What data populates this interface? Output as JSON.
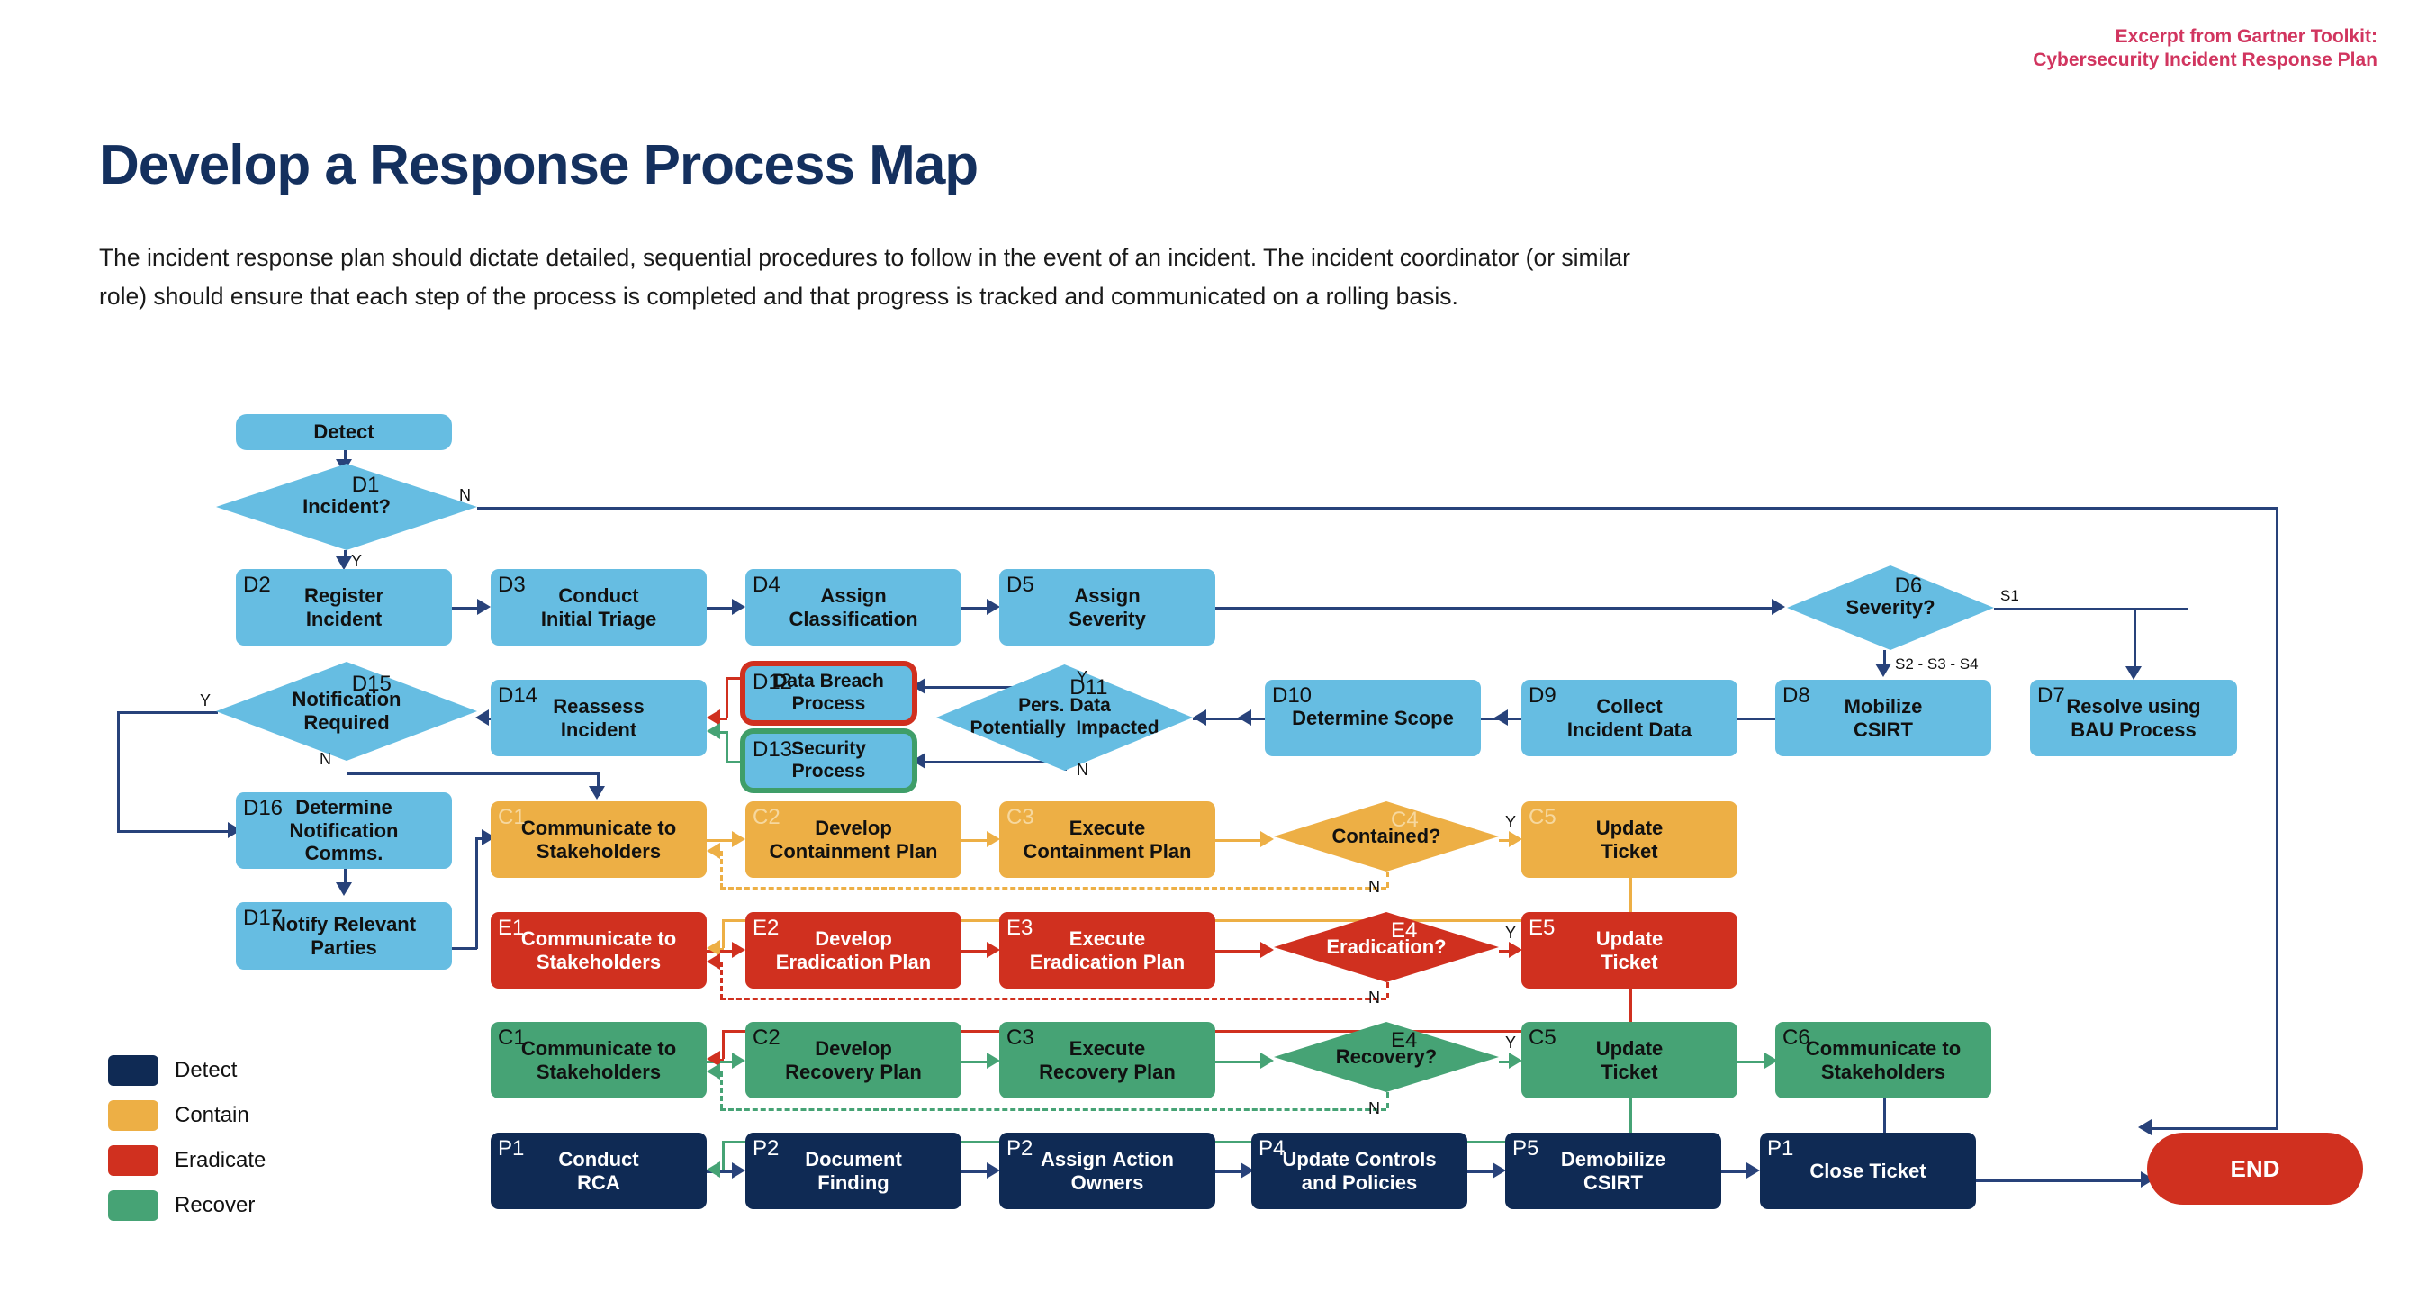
{
  "header": {
    "note_line1": "Excerpt from Gartner Toolkit:",
    "note_line2": "Cybersecurity Incident Response Plan",
    "note_color": "#d1355f"
  },
  "title": "Develop a Response Process Map",
  "subtitle": "The incident response plan should dictate detailed, sequential procedures to follow in the event of an incident. The incident coordinator (or similar role) should ensure that each step of the process is completed and that progress is tracked and communicated on a rolling basis.",
  "palette": {
    "detect_blue": "#66bde2",
    "detect_navy": "#0f2a54",
    "contain_orange": "#edaf45",
    "eradicate_red": "#d0301f",
    "recover_green": "#46a375",
    "connector_navy": "#28427a"
  },
  "start_node": {
    "label": "Detect"
  },
  "end_node": {
    "label": "END"
  },
  "nodes": {
    "d1": {
      "code": "D1",
      "label": "Incident?"
    },
    "d2": {
      "code": "D2",
      "label": "Register\nIncident"
    },
    "d3": {
      "code": "D3",
      "label": "Conduct\nInitial Triage"
    },
    "d4": {
      "code": "D4",
      "label": "Assign\nClassification"
    },
    "d5": {
      "code": "D5",
      "label": "Assign\nSeverity"
    },
    "d6": {
      "code": "D6",
      "label": "Severity?"
    },
    "d7": {
      "code": "D7",
      "label": "Resolve using\nBAU Process"
    },
    "d8": {
      "code": "D8",
      "label": "Mobilize\nCSIRT"
    },
    "d9": {
      "code": "D9",
      "label": "Collect\nIncident Data"
    },
    "d10": {
      "code": "D10",
      "label": "Determine Scope"
    },
    "d11": {
      "code": "D11",
      "label": "Pers. Data\nPotentially  Impacted"
    },
    "d12": {
      "code": "D12",
      "label": "Data Breach\nProcess"
    },
    "d13": {
      "code": "D13",
      "label": "Security\nProcess"
    },
    "d14": {
      "code": "D14",
      "label": "Reassess\nIncident"
    },
    "d15": {
      "code": "D15",
      "label": "Notification\nRequired"
    },
    "d16": {
      "code": "D16",
      "label": "Determine\nNotification\nComms."
    },
    "d17": {
      "code": "D17",
      "label": "Notify Relevant\nParties"
    },
    "c1": {
      "code": "C1",
      "label": "Communicate to\nStakeholders"
    },
    "c2": {
      "code": "C2",
      "label": "Develop\nContainment Plan"
    },
    "c3": {
      "code": "C3",
      "label": "Execute\nContainment Plan"
    },
    "c4": {
      "code": "C4",
      "label": "Contained?"
    },
    "c5": {
      "code": "C5",
      "label": "Update\nTicket"
    },
    "e1": {
      "code": "E1",
      "label": "Communicate to\nStakeholders"
    },
    "e2": {
      "code": "E2",
      "label": "Develop\nEradication Plan"
    },
    "e3": {
      "code": "E3",
      "label": "Execute\nEradication Plan"
    },
    "e4": {
      "code": "E4",
      "label": "Eradication?"
    },
    "e5": {
      "code": "E5",
      "label": "Update\nTicket"
    },
    "r1": {
      "code": "C1",
      "label": "Communicate to\nStakeholders"
    },
    "r2": {
      "code": "C2",
      "label": "Develop\nRecovery Plan"
    },
    "r3": {
      "code": "C3",
      "label": "Execute\nRecovery Plan"
    },
    "r4": {
      "code": "E4",
      "label": "Recovery?"
    },
    "r5": {
      "code": "C5",
      "label": "Update\nTicket"
    },
    "r6": {
      "code": "C6",
      "label": "Communicate to\nStakeholders"
    },
    "p1": {
      "code": "P1",
      "label": "Conduct\nRCA"
    },
    "p2": {
      "code": "P2",
      "label": "Document\nFinding"
    },
    "p3": {
      "code": "P2",
      "label": "Assign Action\nOwners"
    },
    "p4": {
      "code": "P4",
      "label": "Update Controls\nand Policies"
    },
    "p5": {
      "code": "P5",
      "label": "Demobilize\nCSIRT"
    },
    "p6": {
      "code": "P1",
      "label": "Close Ticket"
    }
  },
  "edge_labels": {
    "d1_n": "N",
    "d1_y": "Y",
    "d6_s1": "S1",
    "d6_s234": "S2 - S3 - S4",
    "d11_y": "Y",
    "d11_n": "N",
    "d15_y": "Y",
    "d15_n": "N",
    "c4_y": "Y",
    "c4_n": "N",
    "e4_y": "Y",
    "e4_n": "N",
    "r4_y": "Y",
    "r4_n": "N"
  },
  "legend": {
    "items": [
      {
        "label": "Detect",
        "color": "#0f2a54"
      },
      {
        "label": "Contain",
        "color": "#edaf45"
      },
      {
        "label": "Eradicate",
        "color": "#d0301f"
      },
      {
        "label": "Recover",
        "color": "#46a375"
      }
    ]
  }
}
